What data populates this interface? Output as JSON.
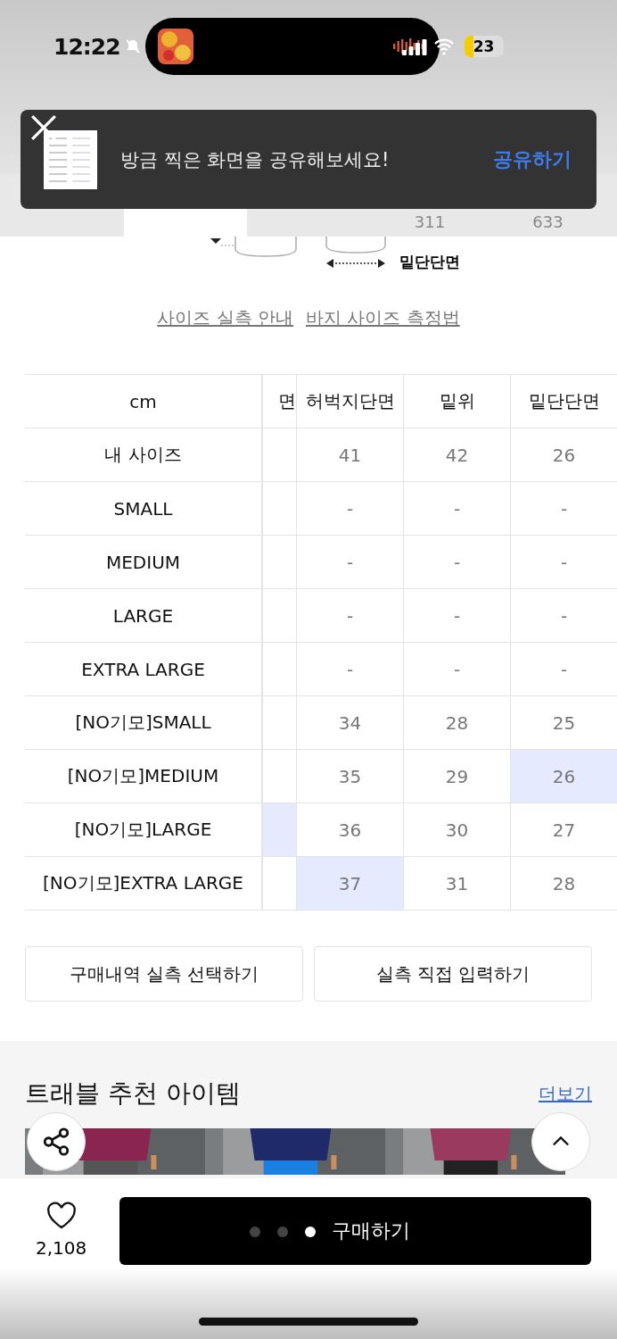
{
  "status_bar": {
    "time": "12:22",
    "battery": "23"
  },
  "toast": {
    "message": "방금 찍은 화면을 공유해보세요!",
    "action": "공유하기"
  },
  "tabs": [
    {
      "selected": false
    },
    {
      "selected": true
    },
    {
      "selected": false
    },
    {
      "count": "311",
      "selected": false
    },
    {
      "count": "633",
      "selected": false
    }
  ],
  "diagram": {
    "label": "밑단단면"
  },
  "links": [
    "사이즈 실측 안내",
    "바지 사이즈 측정법"
  ],
  "table": {
    "columns": [
      "cm",
      "면",
      "허벅지단면",
      "밑위",
      "밑단단면"
    ],
    "rows": [
      {
        "cells": [
          {
            "text": "내 사이즈",
            "highlighted": false
          },
          {
            "text": "",
            "highlighted": false
          },
          {
            "text": "41",
            "highlighted": false
          },
          {
            "text": "42",
            "highlighted": false
          },
          {
            "text": "26",
            "highlighted": false
          }
        ]
      },
      {
        "cells": [
          {
            "text": "SMALL",
            "highlighted": false
          },
          {
            "text": "",
            "highlighted": false
          },
          {
            "text": "-",
            "highlighted": false
          },
          {
            "text": "-",
            "highlighted": false
          },
          {
            "text": "-",
            "highlighted": false
          }
        ]
      },
      {
        "cells": [
          {
            "text": "MEDIUM",
            "highlighted": false
          },
          {
            "text": "",
            "highlighted": false
          },
          {
            "text": "-",
            "highlighted": false
          },
          {
            "text": "-",
            "highlighted": false
          },
          {
            "text": "-",
            "highlighted": false
          }
        ]
      },
      {
        "cells": [
          {
            "text": "LARGE",
            "highlighted": false
          },
          {
            "text": "",
            "highlighted": false
          },
          {
            "text": "-",
            "highlighted": false
          },
          {
            "text": "-",
            "highlighted": false
          },
          {
            "text": "-",
            "highlighted": false
          }
        ]
      },
      {
        "cells": [
          {
            "text": "EXTRA LARGE",
            "highlighted": false
          },
          {
            "text": "",
            "highlighted": false
          },
          {
            "text": "-",
            "highlighted": false
          },
          {
            "text": "-",
            "highlighted": false
          },
          {
            "text": "-",
            "highlighted": false
          }
        ]
      },
      {
        "cells": [
          {
            "text": "[NO기모]SMALL",
            "highlighted": false
          },
          {
            "text": "",
            "highlighted": false
          },
          {
            "text": "34",
            "highlighted": false
          },
          {
            "text": "28",
            "highlighted": false
          },
          {
            "text": "25",
            "highlighted": false
          }
        ]
      },
      {
        "cells": [
          {
            "text": "[NO기모]MEDIUM",
            "highlighted": false
          },
          {
            "text": "",
            "highlighted": false
          },
          {
            "text": "35",
            "highlighted": false
          },
          {
            "text": "29",
            "highlighted": false
          },
          {
            "text": "26",
            "highlighted": true
          }
        ]
      },
      {
        "cells": [
          {
            "text": "[NO기모]LARGE",
            "highlighted": false
          },
          {
            "text": "",
            "highlighted": true
          },
          {
            "text": "36",
            "highlighted": false
          },
          {
            "text": "30",
            "highlighted": false
          },
          {
            "text": "27",
            "highlighted": false
          }
        ]
      },
      {
        "cells": [
          {
            "text": "[NO기모]EXTRA LARGE",
            "highlighted": false
          },
          {
            "text": "",
            "highlighted": false
          },
          {
            "text": "37",
            "highlighted": true
          },
          {
            "text": "31",
            "highlighted": false
          },
          {
            "text": "28",
            "highlighted": false
          }
        ]
      }
    ]
  },
  "actions": [
    "구매내역 실측 선택하기",
    "실측 직접 입력하기"
  ],
  "recommend": {
    "title": "트래블 추천 아이템",
    "more": "더보기"
  },
  "bottom_bar": {
    "likes": "2,108",
    "buy": "구매하기",
    "pages": [
      {
        "selected": false
      },
      {
        "selected": false
      },
      {
        "selected": true
      }
    ]
  }
}
